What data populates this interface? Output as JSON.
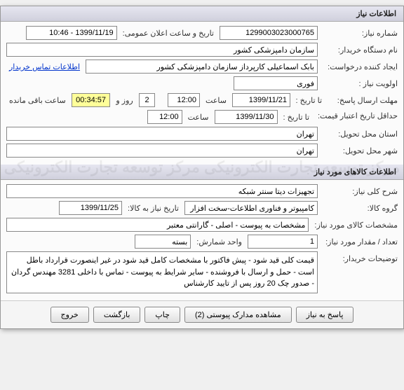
{
  "sections": {
    "need_info": {
      "title": "اطلاعات نیاز"
    },
    "goods_info": {
      "title": "اطلاعات کالاهای مورد نیاز"
    }
  },
  "fields": {
    "need_number": {
      "label": "شماره نیاز:",
      "value": "1299003023000765"
    },
    "announce_date": {
      "label": "تاریخ و ساعت اعلان عمومی:",
      "value": "1399/11/19 - 10:46"
    },
    "device_name": {
      "label": "نام دستگاه خریدار:",
      "value": "سازمان دامپزشکی کشور"
    },
    "creator": {
      "label": "ایجاد کننده درخواست:",
      "value": "بابک اسماعیلی کارپرداز سازمان دامپزشکی کشور"
    },
    "contact_link": {
      "text": "اطلاعات تماس خریدار"
    },
    "priority": {
      "label": "اولویت نیاز :",
      "value": "فوری"
    },
    "deadline_send": {
      "label": "مهلت ارسال پاسخ:",
      "sub": "تا تاریخ :",
      "date": "1399/11/21",
      "time_label": "ساعت",
      "time": "12:00"
    },
    "remaining": {
      "days": "2",
      "days_label": "روز و",
      "time": "00:34:57",
      "suffix": "ساعت باقی مانده"
    },
    "min_valid": {
      "label": "حداقل تاریخ اعتبار\nقیمت:",
      "sub": "تا تاریخ :",
      "date": "1399/11/30",
      "time_label": "ساعت",
      "time": "12:00"
    },
    "province": {
      "label": "استان محل تحویل:",
      "value": "تهران"
    },
    "city": {
      "label": "شهر محل تحویل:",
      "value": "تهران"
    },
    "desc": {
      "label": "شرح کلی نیاز:",
      "value": "تجهیزات دیتا سنتر شبکه"
    },
    "group": {
      "label": "گروه کالا:",
      "value": "کامپیوتر و فناوری اطلاعات-سخت افزار"
    },
    "need_date": {
      "label": "تاریخ نیاز به کالا:",
      "value": "1399/11/25"
    },
    "specs": {
      "label": "مشخصات کالای مورد نیاز:",
      "value": "مشخصات به پیوست - اصلی - گارانتی معتبر"
    },
    "qty": {
      "label": "تعداد / مقدار مورد نیاز:",
      "value": "1"
    },
    "unit": {
      "label": "واحد شمارش:",
      "value": "بسته"
    },
    "notes": {
      "label": "توضیحات خریدار:",
      "value": "قیمت کلی قید شود - پیش فاکتور با مشخصات کامل قید شود  در غیر اینصورت قرارداد باطل است - حمل و ارسال با فروشنده - سایر شرایط به پیوست - تماس با داخلی 3281 مهندس گردان - صدور چک 20 روز پس از تایید کارشناس"
    }
  },
  "buttons": {
    "respond": "پاسخ به نیاز",
    "attachments": "مشاهده مدارک پیوستی (2)",
    "print": "چاپ",
    "back": "بازگشت",
    "exit": "خروج"
  },
  "watermark": "مرکز توسعه تجارت الکترونیکی\nمرکز توسعه تجارت الکترونیکی"
}
